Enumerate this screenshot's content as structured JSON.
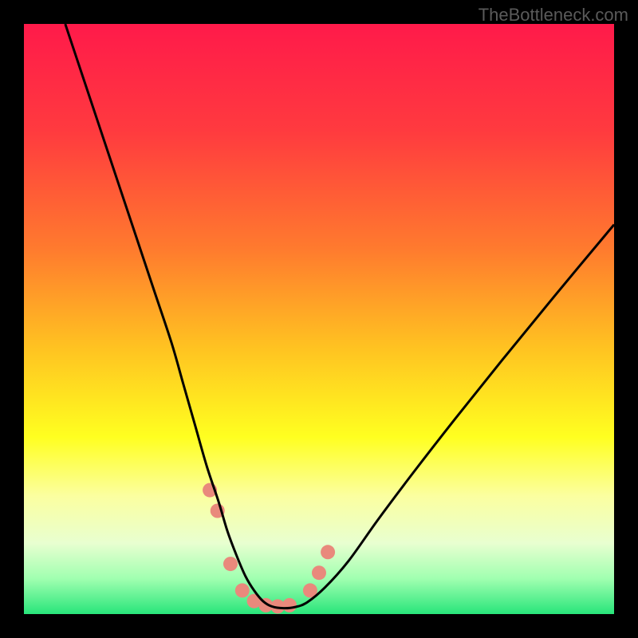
{
  "watermark": "TheBottleneck.com",
  "chart_data": {
    "type": "line",
    "title": "",
    "xlabel": "",
    "ylabel": "",
    "xlim": [
      0,
      100
    ],
    "ylim": [
      0,
      100
    ],
    "background_gradient": {
      "stops": [
        {
          "offset": 0,
          "color": "#ff1a4a"
        },
        {
          "offset": 18,
          "color": "#ff3a3f"
        },
        {
          "offset": 38,
          "color": "#ff7a2e"
        },
        {
          "offset": 55,
          "color": "#ffc321"
        },
        {
          "offset": 70,
          "color": "#ffff20"
        },
        {
          "offset": 80,
          "color": "#fbffa0"
        },
        {
          "offset": 88,
          "color": "#e8ffd0"
        },
        {
          "offset": 94,
          "color": "#a0ffb0"
        },
        {
          "offset": 100,
          "color": "#28e57a"
        }
      ]
    },
    "series": [
      {
        "name": "bottleneck-curve",
        "color": "#000000",
        "x": [
          7,
          10,
          13,
          16,
          19,
          22,
          25,
          27,
          29,
          31,
          33,
          34.5,
          36,
          37.5,
          39,
          40.5,
          42,
          44,
          46,
          48,
          51,
          55,
          60,
          66,
          73,
          81,
          90,
          100
        ],
        "y": [
          100,
          91,
          82,
          73,
          64,
          55,
          46,
          39,
          32,
          25,
          19,
          14,
          10,
          6.5,
          4,
          2.2,
          1.3,
          1.0,
          1.2,
          2.0,
          4.5,
          9,
          16,
          24,
          33,
          43,
          54,
          66
        ]
      }
    ],
    "markers": {
      "name": "highlight-points",
      "color": "#e9897c",
      "radius": 9,
      "points": [
        {
          "x": 31.5,
          "y": 21
        },
        {
          "x": 32.8,
          "y": 17.5
        },
        {
          "x": 35.0,
          "y": 8.5
        },
        {
          "x": 37.0,
          "y": 4.0
        },
        {
          "x": 39.0,
          "y": 2.2
        },
        {
          "x": 41.0,
          "y": 1.5
        },
        {
          "x": 43.0,
          "y": 1.3
        },
        {
          "x": 45.0,
          "y": 1.5
        },
        {
          "x": 48.5,
          "y": 4.0
        },
        {
          "x": 50.0,
          "y": 7.0
        },
        {
          "x": 51.5,
          "y": 10.5
        }
      ]
    }
  }
}
